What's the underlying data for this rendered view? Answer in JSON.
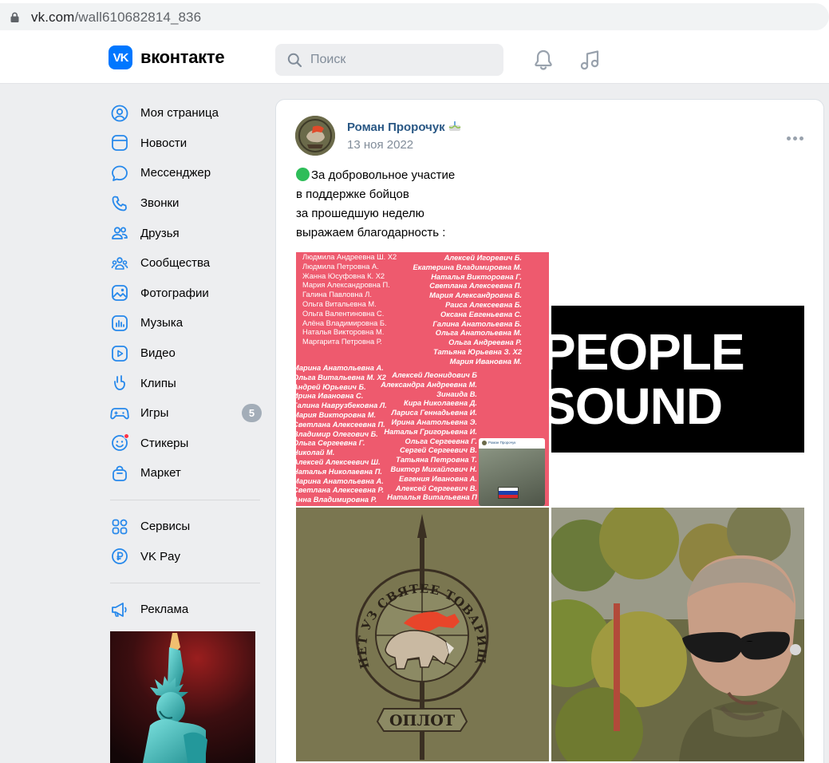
{
  "browser": {
    "url_domain": "vk.com",
    "url_path": "/wall610682814_836"
  },
  "header": {
    "logo_text": "вконтакте",
    "logo_mark": "VK",
    "search_placeholder": "Поиск",
    "icons": [
      "bell-icon",
      "music-icon"
    ]
  },
  "sidebar": {
    "items": [
      {
        "label": "Моя страница",
        "icon": "user-circle-icon"
      },
      {
        "label": "Новости",
        "icon": "news-icon"
      },
      {
        "label": "Мессенджер",
        "icon": "message-icon"
      },
      {
        "label": "Звонки",
        "icon": "phone-icon"
      },
      {
        "label": "Друзья",
        "icon": "friends-icon"
      },
      {
        "label": "Сообщества",
        "icon": "communities-icon"
      },
      {
        "label": "Фотографии",
        "icon": "photo-icon"
      },
      {
        "label": "Музыка",
        "icon": "music-icon"
      },
      {
        "label": "Видео",
        "icon": "video-icon"
      },
      {
        "label": "Клипы",
        "icon": "clips-icon"
      },
      {
        "label": "Игры",
        "icon": "gamepad-icon",
        "badge": "5"
      },
      {
        "label": "Стикеры",
        "icon": "sticker-icon"
      },
      {
        "label": "Маркет",
        "icon": "market-icon"
      }
    ],
    "items2": [
      {
        "label": "Сервисы",
        "icon": "services-icon"
      },
      {
        "label": "VK Pay",
        "icon": "vkpay-icon"
      }
    ],
    "items3": [
      {
        "label": "Реклама",
        "icon": "megaphone-icon"
      }
    ]
  },
  "post": {
    "author": "Роман Пророчук",
    "date": "13 ноя 2022",
    "text_lines": [
      "За добровольное участие",
      "в поддержке бойцов",
      "за прошедшую неделю",
      "выражаем благодарность :"
    ],
    "photo1": {
      "col1": [
        "Людмила Андреевна Ш. Х2",
        "Людмила Петровна А.",
        "Жанна Юсуфовна К. Х2",
        "Мария Александровна П.",
        "Галина Павловна Л.",
        "Ольга Витальевна М.",
        "Ольга Валентиновна С.",
        "Алёна Владимировна Б.",
        "Наталья Викторовна М.",
        "Маргарита Петровна Р."
      ],
      "col2": [
        "Алексей Игоревич Б.",
        "Екатерина Владимировна М.",
        "Наталья Викторовна Г.",
        "Светлана Алексеевна П.",
        "Мария Александровна Б.",
        "Раиса Алексеевна Б.",
        "Оксана Евгеньевна С.",
        "Галина Анатольевна Б.",
        "Ольга Анатольевна М.",
        "Ольга Андреевна Р.",
        "Татьяна Юрьевна З. Х2",
        "Мария Ивановна М."
      ],
      "col3": [
        "Марина Анатольевна А.",
        "Ольга Витальевна М. Х2",
        "Андрей Юрьевич Б.",
        "Ирина Ивановна С.",
        "Галина Наврузбековна Л.",
        "Мария Викторовна М.",
        "Светлана Алексеевна П.",
        "Владимир Олегович Б.",
        "Ольга Сергеевна Г.",
        "Николай М.",
        "Алексей Алексеевич Ш.",
        "Наталья Николаевна П.",
        "Марина Анатольевна А.",
        "Светлана Алексеевна Р.",
        "Анна Владимировна Р."
      ],
      "col4": [
        "Алексей Леонидович Б",
        "Александра Андреевна М.",
        "Зинаида В.",
        "Кира Николаевна Д.",
        "Лариса Геннадьевна И.",
        "Ирина Анатольевна Э.",
        "Наталья Григорьевна И.",
        "Ольга Сергеевна Г.",
        "Сергей Сергеевич В.",
        "Татьяна Петровна Т.",
        "Виктор Михайлович Н.",
        "Евгения Ивановна А.",
        "Алексей Сергеевич В.",
        "Наталья Витальевна П"
      ],
      "inset_author": "Роман Пророчук"
    },
    "photo2": {
      "line1": "PEOPLE",
      "line2": "SOUND"
    },
    "photo3": {
      "emblem_arc": "НЕТ УЗ СВЯТЕЕ ТОВАРИЩЕСТВА",
      "emblem_banner": "ОПЛОТ"
    }
  }
}
